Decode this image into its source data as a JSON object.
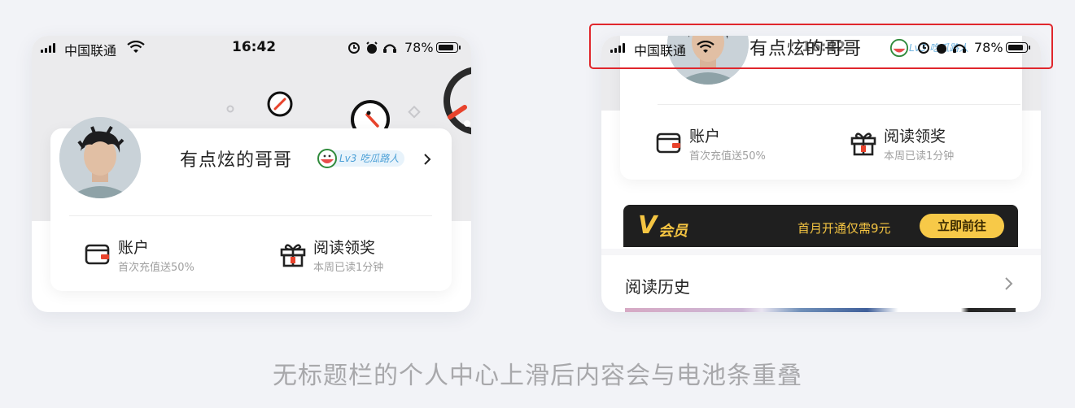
{
  "status_bar": {
    "carrier": "中国联通",
    "time": "16:42",
    "battery_pct": "78%"
  },
  "profile": {
    "username": "有点炫的哥哥",
    "level_badge": "Lv3 吃瓜路人"
  },
  "quick_entries": [
    {
      "title": "账户",
      "subtitle": "首次充值送50%",
      "icon": "wallet-icon"
    },
    {
      "title": "阅读领奖",
      "subtitle": "本周已读1分钟",
      "icon": "gift-icon"
    }
  ],
  "vip_banner": {
    "logo": "V",
    "label": "会员",
    "promo": "首月开通仅需9元",
    "button": "立即前往"
  },
  "reading_history": {
    "title": "阅读历史"
  },
  "overlay": {
    "badge_text": "Lv3 吃瓜路人"
  },
  "caption": "无标题栏的个人中心上滑后内容会与电池条重叠",
  "colors": {
    "accent_red": "#e0262c",
    "vip_gold": "#f5c542",
    "badge_blue": "#4a9fd6"
  }
}
